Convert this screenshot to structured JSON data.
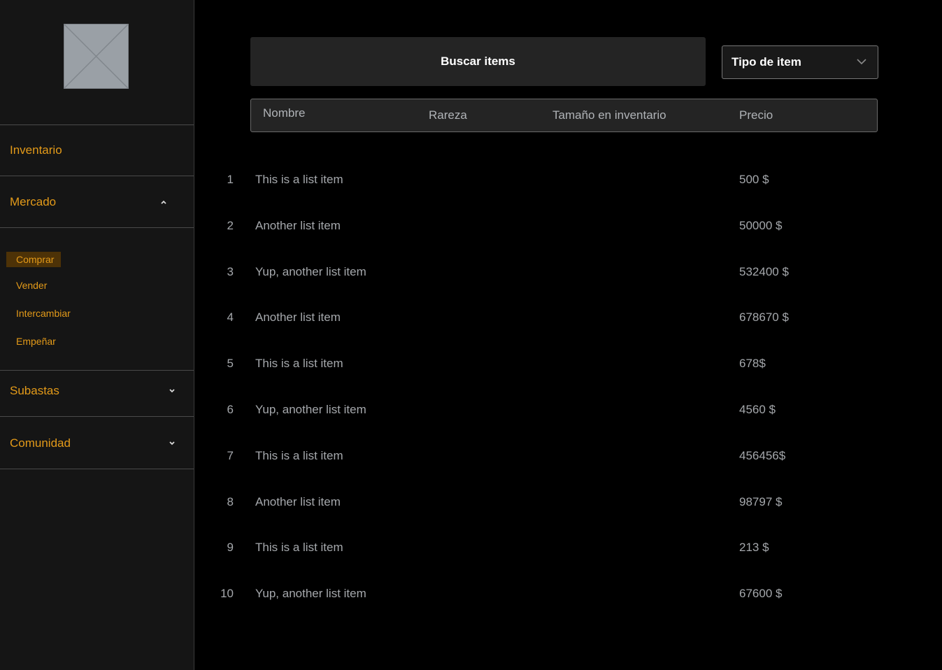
{
  "sidebar": {
    "logo": "image-placeholder-icon",
    "nav": [
      {
        "label": "Inventario"
      },
      {
        "label": "Mercado",
        "expanded": true
      },
      {
        "label": "Subastas",
        "expanded": false
      },
      {
        "label": "Comunidad",
        "expanded": false
      }
    ],
    "submenu": [
      {
        "label": "Comprar",
        "active": true
      },
      {
        "label": "Vender"
      },
      {
        "label": "Intercambiar"
      },
      {
        "label": "Empeñar"
      }
    ]
  },
  "search": {
    "label": "Buscar items"
  },
  "filter": {
    "selected": "Tipo de item",
    "icon": "chevron-down-icon"
  },
  "table": {
    "columns": [
      "Nombre",
      "Rareza",
      "Tamaño en inventario",
      "Precio"
    ],
    "rows": [
      {
        "num": "1",
        "name": "This is a list item",
        "price": "500 $"
      },
      {
        "num": "2",
        "name": "Another list item",
        "price": "50000 $"
      },
      {
        "num": "3",
        "name": "Yup, another list item",
        "price": "532400 $"
      },
      {
        "num": "4",
        "name": "Another list item",
        "price": "678670 $"
      },
      {
        "num": "5",
        "name": "This is a list item",
        "price": "678$"
      },
      {
        "num": "6",
        "name": "Yup, another list item",
        "price": "4560 $"
      },
      {
        "num": "7",
        "name": "This is a list item",
        "price": "456456$"
      },
      {
        "num": "8",
        "name": "Another list item",
        "price": "98797 $"
      },
      {
        "num": "9",
        "name": "This is a list item",
        "price": "213 $"
      },
      {
        "num": "10",
        "name": "Yup, another list item",
        "price": "67600 $"
      }
    ]
  },
  "colors": {
    "accent": "#e39a19",
    "active_bg": "#4d3207",
    "sidebar_bg": "#151515",
    "panel_bg": "#242424",
    "text_muted": "#a5a8ac"
  }
}
